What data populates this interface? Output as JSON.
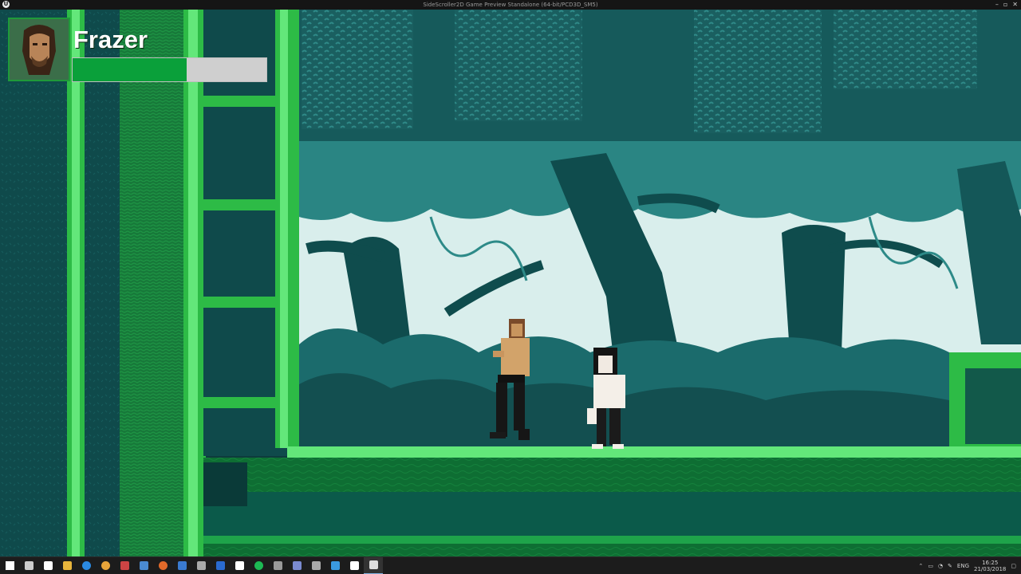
{
  "window": {
    "title": "SideScroller2D Game Preview Standalone (64-bit/PCD3D_SM5)",
    "app_icon": "unreal-engine-icon",
    "controls": [
      "minimize-icon",
      "restore-icon",
      "close-icon"
    ]
  },
  "hud": {
    "player_name": "Frazer",
    "health_fraction": 0.59,
    "health_color": "#0aa03a",
    "health_empty_color": "#cfcfcf",
    "portrait_icon": "player-portrait-icon"
  },
  "scene": {
    "characters": [
      {
        "role": "player",
        "icon": "shirtless-fighter-sprite"
      },
      {
        "role": "npc",
        "icon": "long-haired-figure-sprite"
      }
    ],
    "colors": {
      "sky": "#d9eeec",
      "deep_teal": "#0f4a4c",
      "mid_teal": "#1b6b6c",
      "light_teal": "#2d8a88",
      "grass": "#2dbb46",
      "grass_bright": "#63e77a",
      "ground": "#0d6b33"
    }
  },
  "taskbar": {
    "icons": [
      "windows-start-icon",
      "task-view-icon",
      "store-icon",
      "file-explorer-icon",
      "edge-icon",
      "chrome-icon",
      "app-icon",
      "steam-icon",
      "origin-icon",
      "outlook-icon",
      "terminal-icon",
      "photoshop-icon",
      "notes-icon",
      "spotify-icon",
      "app-icon",
      "app-icon",
      "app-icon",
      "app-icon",
      "unity-icon",
      "unreal-icon"
    ],
    "icon_colors": [
      "#ffffff",
      "#cccccc",
      "#ffffff",
      "#e8b53c",
      "#2b8ae2",
      "#e8a43a",
      "#cc4444",
      "#4a8ad0",
      "#e26a2a",
      "#3a7ad0",
      "#aaaaaa",
      "#2a6ad0",
      "#ffffff",
      "#1db954",
      "#9a9a9a",
      "#7a8ad0",
      "#aaaaaa",
      "#3a9ae0",
      "#ffffff",
      "#dddddd"
    ],
    "active_index": 19,
    "tray_lang": "ENG",
    "time": "16:25",
    "date": "21/03/2018"
  }
}
